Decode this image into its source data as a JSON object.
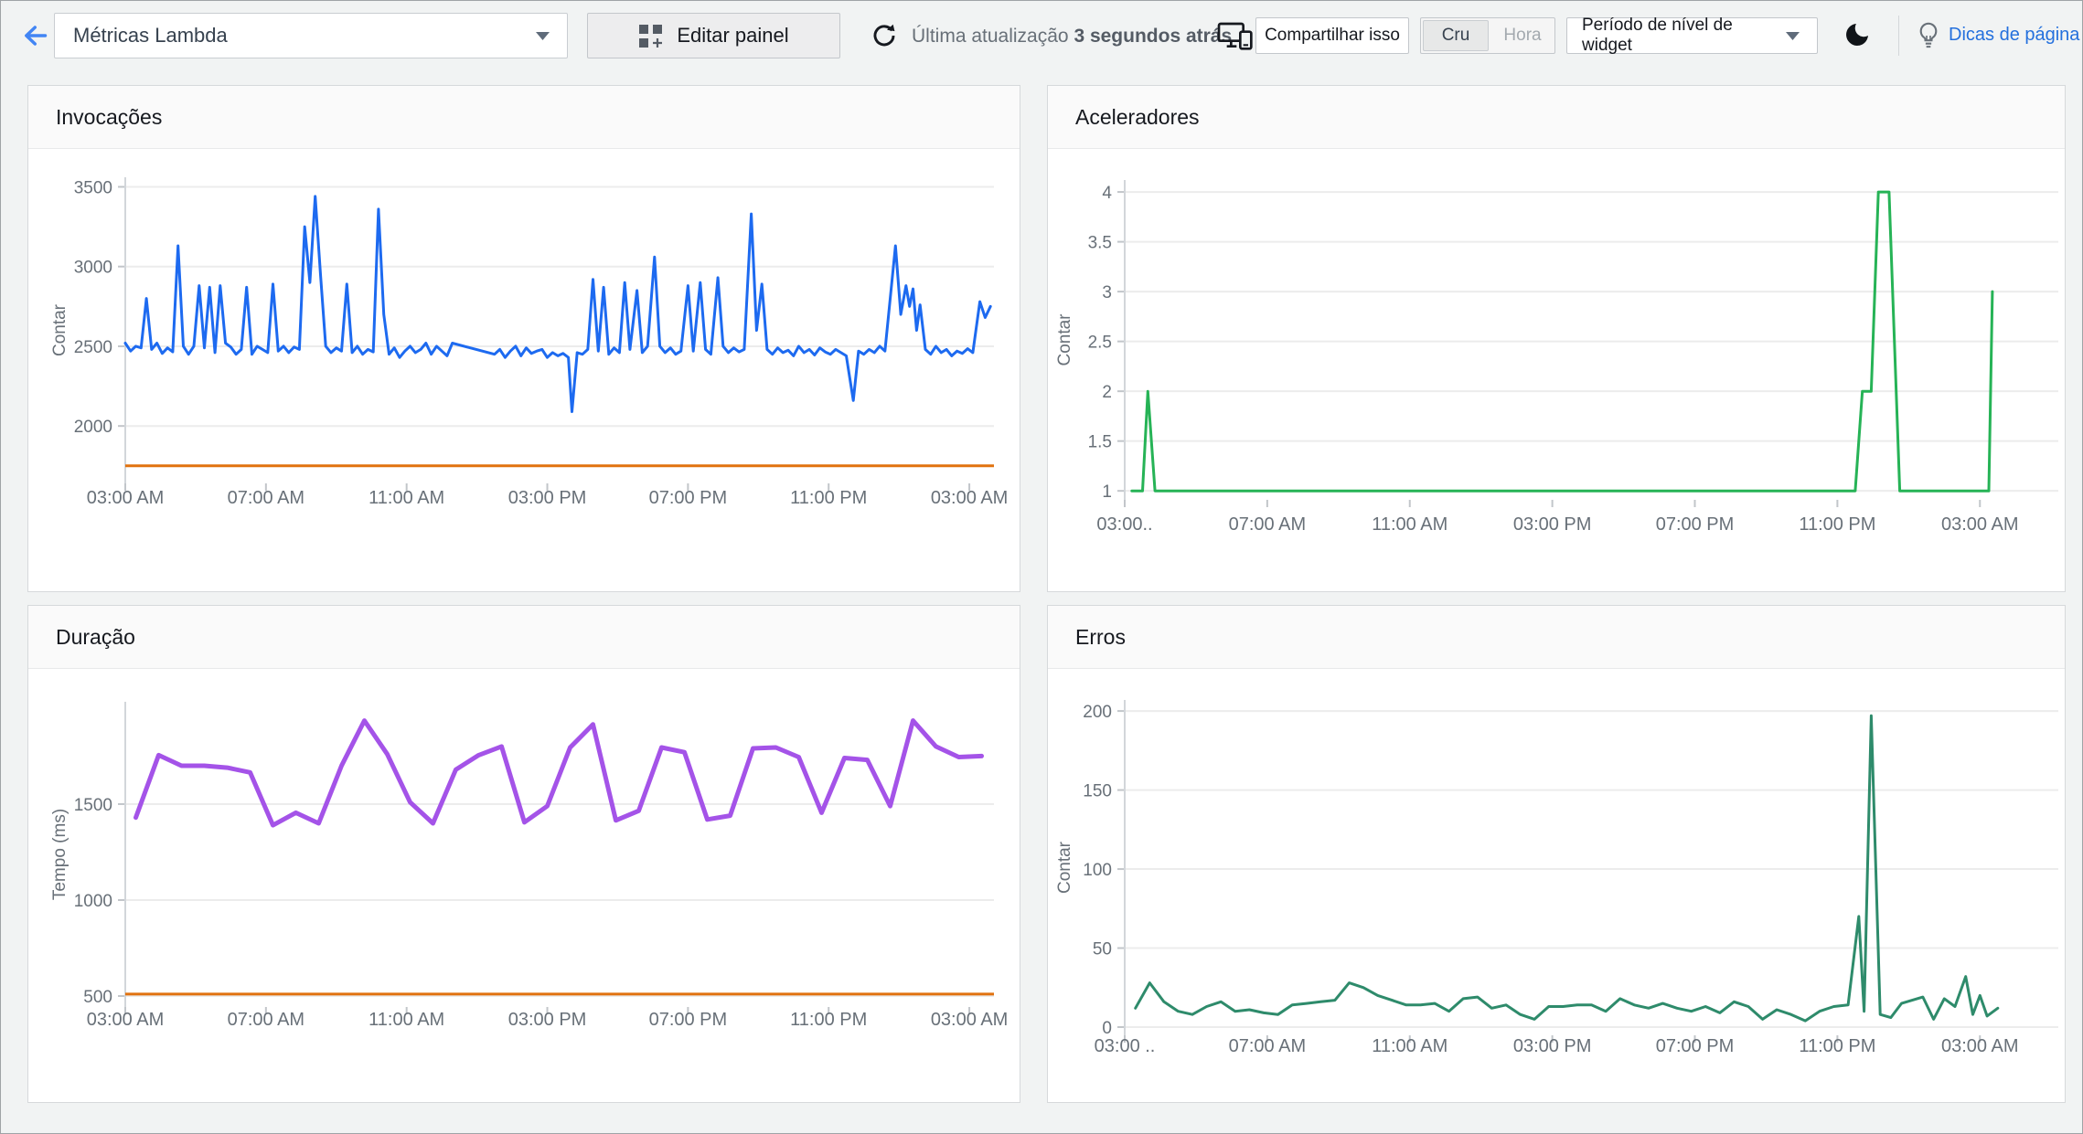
{
  "topbar": {
    "dashboard_select": "Métricas Lambda",
    "edit_button": "Editar painel",
    "refresh_prefix": "Última atualização",
    "refresh_time": "3 segundos atrás",
    "share_button": "Compartilhar isso",
    "toggle_raw": "Cru",
    "toggle_time": "Hora",
    "period_select": "Período de nível de widget",
    "tips_link": "Dicas de página"
  },
  "colors": {
    "back_arrow_blue": "#4285f4",
    "link_blue": "#2470dd",
    "invocations_blue": "#1d6af0",
    "throttles_green": "#26b356",
    "duration_purple": "#a453e8",
    "errors_teal": "#2e8b6b",
    "threshold_orange": "#e1720f"
  },
  "charts": [
    {
      "id": "invocacoes",
      "type": "line",
      "title": "Invocações",
      "ylabel": "Contar",
      "color": "#1d6af0",
      "stroke_width": 3,
      "y_ticks": [
        3500,
        3000,
        2500,
        2000
      ],
      "x_ticks": [
        "03:00 AM",
        "07:00 AM",
        "11:00 AM",
        "03:00 PM",
        "07:00 PM",
        "11:00 PM",
        "03:00 AM"
      ],
      "threshold": {
        "value": 1750,
        "color": "#e1720f"
      },
      "points": [
        [
          0.0,
          2520
        ],
        [
          0.15,
          2470
        ],
        [
          0.3,
          2500
        ],
        [
          0.45,
          2490
        ],
        [
          0.6,
          2800
        ],
        [
          0.75,
          2480
        ],
        [
          0.9,
          2520
        ],
        [
          1.05,
          2455
        ],
        [
          1.2,
          2490
        ],
        [
          1.35,
          2465
        ],
        [
          1.5,
          3130
        ],
        [
          1.65,
          2500
        ],
        [
          1.8,
          2450
        ],
        [
          1.95,
          2500
        ],
        [
          2.1,
          2880
        ],
        [
          2.25,
          2490
        ],
        [
          2.4,
          2870
        ],
        [
          2.55,
          2460
        ],
        [
          2.7,
          2880
        ],
        [
          2.85,
          2520
        ],
        [
          3.0,
          2495
        ],
        [
          3.15,
          2450
        ],
        [
          3.3,
          2480
        ],
        [
          3.45,
          2870
        ],
        [
          3.6,
          2450
        ],
        [
          3.75,
          2500
        ],
        [
          3.9,
          2480
        ],
        [
          4.05,
          2460
        ],
        [
          4.2,
          2890
        ],
        [
          4.35,
          2470
        ],
        [
          4.5,
          2500
        ],
        [
          4.65,
          2460
        ],
        [
          4.8,
          2495
        ],
        [
          4.95,
          2480
        ],
        [
          5.1,
          3250
        ],
        [
          5.25,
          2900
        ],
        [
          5.4,
          3440
        ],
        [
          5.55,
          2950
        ],
        [
          5.7,
          2500
        ],
        [
          5.85,
          2460
        ],
        [
          6.0,
          2490
        ],
        [
          6.15,
          2470
        ],
        [
          6.3,
          2890
        ],
        [
          6.45,
          2460
        ],
        [
          6.6,
          2500
        ],
        [
          6.75,
          2450
        ],
        [
          6.9,
          2480
        ],
        [
          7.05,
          2465
        ],
        [
          7.2,
          3360
        ],
        [
          7.35,
          2700
        ],
        [
          7.5,
          2450
        ],
        [
          7.65,
          2490
        ],
        [
          7.8,
          2430
        ],
        [
          7.95,
          2470
        ],
        [
          8.1,
          2500
        ],
        [
          8.25,
          2460
        ],
        [
          8.4,
          2480
        ],
        [
          8.55,
          2520
        ],
        [
          8.7,
          2450
        ],
        [
          8.85,
          2500
        ],
        [
          9.0,
          2470
        ],
        [
          9.15,
          2440
        ],
        [
          9.3,
          2520
        ],
        [
          10.5,
          2450
        ],
        [
          10.65,
          2480
        ],
        [
          10.8,
          2430
        ],
        [
          10.95,
          2470
        ],
        [
          11.1,
          2500
        ],
        [
          11.25,
          2440
        ],
        [
          11.4,
          2490
        ],
        [
          11.55,
          2455
        ],
        [
          11.7,
          2470
        ],
        [
          11.85,
          2480
        ],
        [
          12.0,
          2430
        ],
        [
          12.15,
          2460
        ],
        [
          12.3,
          2440
        ],
        [
          12.45,
          2455
        ],
        [
          12.6,
          2430
        ],
        [
          12.7,
          2090
        ],
        [
          12.85,
          2460
        ],
        [
          13.0,
          2450
        ],
        [
          13.15,
          2480
        ],
        [
          13.3,
          2920
        ],
        [
          13.45,
          2470
        ],
        [
          13.6,
          2870
        ],
        [
          13.75,
          2450
        ],
        [
          13.9,
          2490
        ],
        [
          14.05,
          2460
        ],
        [
          14.2,
          2900
        ],
        [
          14.35,
          2480
        ],
        [
          14.55,
          2850
        ],
        [
          14.7,
          2460
        ],
        [
          14.85,
          2500
        ],
        [
          15.05,
          3060
        ],
        [
          15.2,
          2500
        ],
        [
          15.35,
          2460
        ],
        [
          15.5,
          2490
        ],
        [
          15.65,
          2450
        ],
        [
          15.8,
          2470
        ],
        [
          16.0,
          2880
        ],
        [
          16.15,
          2470
        ],
        [
          16.35,
          2900
        ],
        [
          16.5,
          2480
        ],
        [
          16.65,
          2450
        ],
        [
          16.85,
          2930
        ],
        [
          17.0,
          2500
        ],
        [
          17.15,
          2460
        ],
        [
          17.3,
          2490
        ],
        [
          17.45,
          2465
        ],
        [
          17.6,
          2480
        ],
        [
          17.8,
          3330
        ],
        [
          17.95,
          2600
        ],
        [
          18.1,
          2890
        ],
        [
          18.25,
          2480
        ],
        [
          18.4,
          2450
        ],
        [
          18.55,
          2490
        ],
        [
          18.7,
          2460
        ],
        [
          18.85,
          2475
        ],
        [
          19.0,
          2440
        ],
        [
          19.15,
          2500
        ],
        [
          19.3,
          2460
        ],
        [
          19.45,
          2480
        ],
        [
          19.6,
          2445
        ],
        [
          19.75,
          2490
        ],
        [
          19.9,
          2465
        ],
        [
          20.05,
          2450
        ],
        [
          20.2,
          2480
        ],
        [
          20.35,
          2460
        ],
        [
          20.5,
          2440
        ],
        [
          20.7,
          2160
        ],
        [
          20.85,
          2470
        ],
        [
          21.0,
          2450
        ],
        [
          21.15,
          2480
        ],
        [
          21.3,
          2460
        ],
        [
          21.45,
          2500
        ],
        [
          21.6,
          2470
        ],
        [
          21.9,
          3130
        ],
        [
          22.05,
          2700
        ],
        [
          22.2,
          2880
        ],
        [
          22.3,
          2750
        ],
        [
          22.4,
          2860
        ],
        [
          22.5,
          2600
        ],
        [
          22.6,
          2760
        ],
        [
          22.75,
          2480
        ],
        [
          22.9,
          2450
        ],
        [
          23.05,
          2500
        ],
        [
          23.2,
          2460
        ],
        [
          23.35,
          2480
        ],
        [
          23.5,
          2440
        ],
        [
          23.65,
          2470
        ],
        [
          23.8,
          2455
        ],
        [
          23.95,
          2485
        ],
        [
          24.1,
          2460
        ],
        [
          24.3,
          2780
        ],
        [
          24.45,
          2680
        ],
        [
          24.6,
          2750
        ]
      ]
    },
    {
      "id": "aceleradores",
      "type": "line",
      "title": "Aceleradores",
      "ylabel": "Contar",
      "color": "#26b356",
      "stroke_width": 3,
      "y_ticks": [
        4,
        3.5,
        3,
        2.5,
        2,
        1.5,
        1
      ],
      "x_ticks": [
        "03:00..",
        "07:00 AM",
        "11:00 AM",
        "03:00 PM",
        "07:00 PM",
        "11:00 PM",
        "03:00 AM"
      ],
      "points": [
        [
          0.2,
          1
        ],
        [
          0.5,
          1
        ],
        [
          0.65,
          2
        ],
        [
          0.85,
          1
        ],
        [
          1.1,
          1
        ],
        [
          20.5,
          1
        ],
        [
          20.7,
          2
        ],
        [
          20.95,
          2
        ],
        [
          21.15,
          4
        ],
        [
          21.45,
          4
        ],
        [
          21.75,
          1
        ],
        [
          24.25,
          1
        ],
        [
          24.35,
          3
        ]
      ]
    },
    {
      "id": "duracao",
      "type": "line",
      "title": "Duração",
      "ylabel": "Tempo (ms)",
      "color": "#a453e8",
      "stroke_width": 5,
      "y_ticks": [
        1500,
        1000,
        500
      ],
      "x_ticks": [
        "03:00 AM",
        "07:00 AM",
        "11:00 AM",
        "03:00 PM",
        "07:00 PM",
        "11:00 PM",
        "03:00 AM"
      ],
      "threshold": {
        "value": 510,
        "color": "#e1720f"
      },
      "points": [
        [
          0.3,
          1430
        ],
        [
          0.95,
          1755
        ],
        [
          1.6,
          1700
        ],
        [
          2.25,
          1700
        ],
        [
          2.9,
          1690
        ],
        [
          3.55,
          1665
        ],
        [
          4.2,
          1390
        ],
        [
          4.85,
          1455
        ],
        [
          5.5,
          1400
        ],
        [
          6.15,
          1700
        ],
        [
          6.8,
          1935
        ],
        [
          7.45,
          1760
        ],
        [
          8.1,
          1510
        ],
        [
          8.75,
          1400
        ],
        [
          9.4,
          1680
        ],
        [
          10.05,
          1755
        ],
        [
          10.7,
          1800
        ],
        [
          11.35,
          1405
        ],
        [
          12.0,
          1490
        ],
        [
          12.65,
          1795
        ],
        [
          13.3,
          1915
        ],
        [
          13.95,
          1415
        ],
        [
          14.6,
          1465
        ],
        [
          15.25,
          1795
        ],
        [
          15.9,
          1770
        ],
        [
          16.55,
          1420
        ],
        [
          17.2,
          1440
        ],
        [
          17.85,
          1790
        ],
        [
          18.5,
          1795
        ],
        [
          19.15,
          1745
        ],
        [
          19.8,
          1455
        ],
        [
          20.45,
          1740
        ],
        [
          21.1,
          1730
        ],
        [
          21.75,
          1490
        ],
        [
          22.4,
          1935
        ],
        [
          23.05,
          1800
        ],
        [
          23.7,
          1745
        ],
        [
          24.35,
          1750
        ]
      ]
    },
    {
      "id": "erros",
      "type": "line",
      "title": "Erros",
      "ylabel": "Contar",
      "color": "#2e8b6b",
      "stroke_width": 3,
      "y_ticks": [
        200,
        150,
        100,
        50,
        0
      ],
      "x_ticks": [
        "03:00 ..",
        "07:00 AM",
        "11:00 AM",
        "03:00 PM",
        "07:00 PM",
        "11:00 PM",
        "03:00 AM"
      ],
      "points": [
        [
          0.3,
          12
        ],
        [
          0.7,
          28
        ],
        [
          1.1,
          16
        ],
        [
          1.5,
          10
        ],
        [
          1.9,
          8
        ],
        [
          2.3,
          13
        ],
        [
          2.7,
          16
        ],
        [
          3.1,
          10
        ],
        [
          3.5,
          11
        ],
        [
          3.9,
          9
        ],
        [
          4.3,
          8
        ],
        [
          4.7,
          14
        ],
        [
          5.1,
          15
        ],
        [
          5.5,
          16
        ],
        [
          5.9,
          17
        ],
        [
          6.3,
          28
        ],
        [
          6.7,
          25
        ],
        [
          7.1,
          20
        ],
        [
          7.5,
          17
        ],
        [
          7.9,
          14
        ],
        [
          8.3,
          14
        ],
        [
          8.7,
          15
        ],
        [
          9.1,
          10
        ],
        [
          9.5,
          18
        ],
        [
          9.9,
          19
        ],
        [
          10.3,
          12
        ],
        [
          10.7,
          14
        ],
        [
          11.1,
          8
        ],
        [
          11.5,
          5
        ],
        [
          11.9,
          13
        ],
        [
          12.3,
          13
        ],
        [
          12.7,
          14
        ],
        [
          13.1,
          14
        ],
        [
          13.5,
          10
        ],
        [
          13.9,
          18
        ],
        [
          14.3,
          14
        ],
        [
          14.7,
          12
        ],
        [
          15.1,
          15
        ],
        [
          15.5,
          12
        ],
        [
          15.9,
          10
        ],
        [
          16.3,
          13
        ],
        [
          16.7,
          9
        ],
        [
          17.1,
          16
        ],
        [
          17.5,
          13
        ],
        [
          17.9,
          5
        ],
        [
          18.3,
          11
        ],
        [
          18.7,
          8
        ],
        [
          19.1,
          4
        ],
        [
          19.5,
          10
        ],
        [
          19.9,
          13
        ],
        [
          20.3,
          14
        ],
        [
          20.6,
          70
        ],
        [
          20.75,
          10
        ],
        [
          20.95,
          197
        ],
        [
          21.2,
          8
        ],
        [
          21.5,
          6
        ],
        [
          21.8,
          15
        ],
        [
          22.1,
          17
        ],
        [
          22.4,
          19
        ],
        [
          22.7,
          5
        ],
        [
          23.0,
          18
        ],
        [
          23.3,
          13
        ],
        [
          23.6,
          32
        ],
        [
          23.8,
          8
        ],
        [
          24.0,
          20
        ],
        [
          24.2,
          7
        ],
        [
          24.5,
          12
        ]
      ]
    }
  ]
}
